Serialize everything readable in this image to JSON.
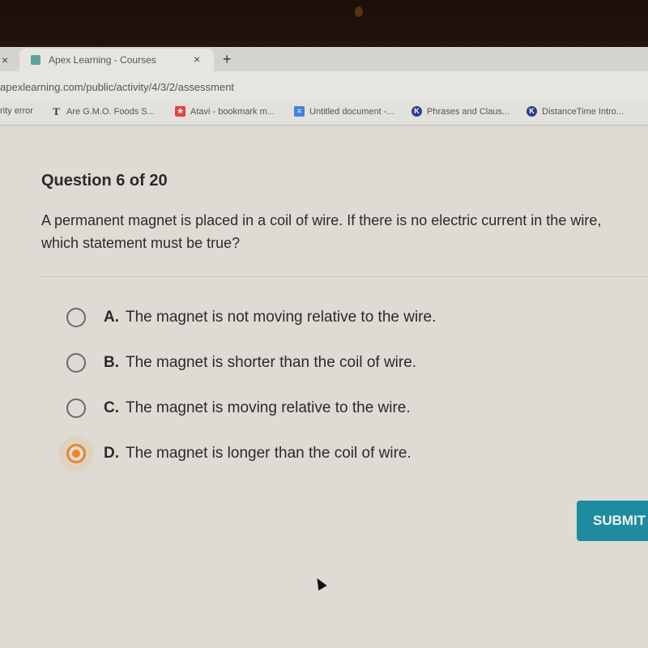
{
  "browser": {
    "active_tab": {
      "title": "Apex Learning - Courses"
    },
    "new_tab_label": "+",
    "close_label": "×",
    "url": "apexlearning.com/public/activity/4/3/2/assessment",
    "bookmarks": [
      {
        "label": "rity error",
        "icon": "none"
      },
      {
        "label": "Are G.M.O. Foods S...",
        "icon": "nyt-icon"
      },
      {
        "label": "Atavi - bookmark m...",
        "icon": "atavi-icon"
      },
      {
        "label": "Untitled document -...",
        "icon": "google-docs-icon"
      },
      {
        "label": "Phrases and Claus...",
        "icon": "k-icon"
      },
      {
        "label": "DistanceTime Intro...",
        "icon": "k-icon"
      }
    ]
  },
  "question": {
    "title": "Question 6 of 20",
    "text": "A permanent magnet is placed in a coil of wire. If there is no electric current in the wire, which statement must be true?",
    "options": [
      {
        "letter": "A.",
        "text": "The magnet is not moving relative to the wire.",
        "selected": false
      },
      {
        "letter": "B.",
        "text": "The magnet is shorter than the coil of wire.",
        "selected": false
      },
      {
        "letter": "C.",
        "text": "The magnet is moving relative to the wire.",
        "selected": false
      },
      {
        "letter": "D.",
        "text": "The magnet is longer than the coil of wire.",
        "selected": true
      }
    ]
  },
  "submit_label": "SUBMIT",
  "colors": {
    "accent": "#1d8c9e",
    "selected_radio": "#ee8525"
  }
}
